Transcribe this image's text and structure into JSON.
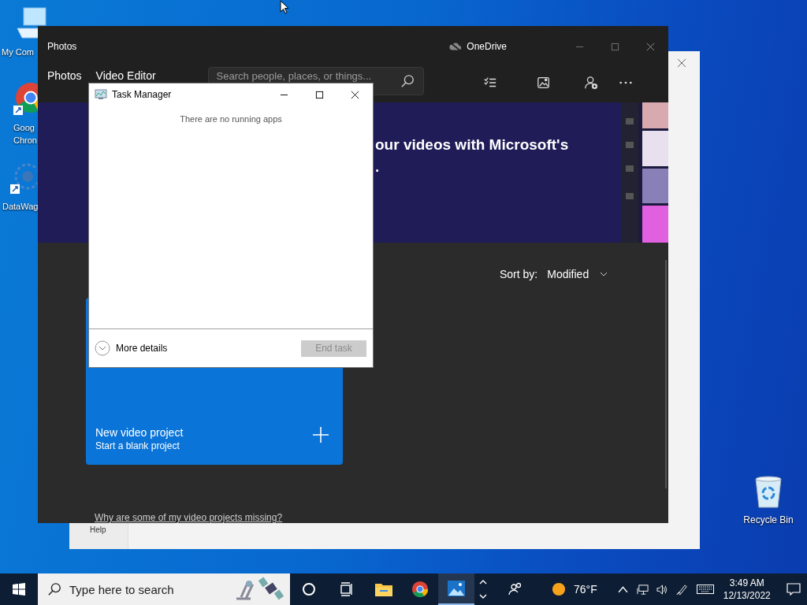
{
  "desktop": {
    "icons": [
      {
        "kind": "computer",
        "lines": [
          "My Com"
        ]
      },
      {
        "kind": "chrome",
        "lines": [
          "Goog",
          "Chron"
        ]
      },
      {
        "kind": "molecule",
        "lines": [
          "DataWag"
        ]
      }
    ],
    "recycle_bin": {
      "label": "Recycle Bin"
    }
  },
  "background_window": {
    "help_label": "Help"
  },
  "photos_window": {
    "title": "Photos",
    "onedrive_label": "OneDrive",
    "nav_items": [
      "Photos",
      "Video Editor"
    ],
    "search": {
      "placeholder": "Search people, places, or things..."
    },
    "banner": {
      "lines": [
        "our videos with Microsoft's",
        "."
      ]
    },
    "sort": {
      "label": "Sort by:",
      "value": "Modified"
    },
    "new_project_card": {
      "title": "New video project",
      "subtitle": "Start a blank project"
    },
    "help_link": "Why are some of my video projects missing?"
  },
  "task_manager": {
    "title": "Task Manager",
    "empty_message": "There are no running apps",
    "more_details": "More details",
    "end_task": {
      "label": "End task",
      "disabled": true
    }
  },
  "taskbar": {
    "search": {
      "placeholder": "Type here to search"
    },
    "apps": [
      {
        "kind": "explorer",
        "active": false
      },
      {
        "kind": "chrome",
        "active": false
      },
      {
        "kind": "photos",
        "active": true
      }
    ],
    "weather": "76°F",
    "time": "3:49 AM",
    "date": "12/13/2022"
  }
}
